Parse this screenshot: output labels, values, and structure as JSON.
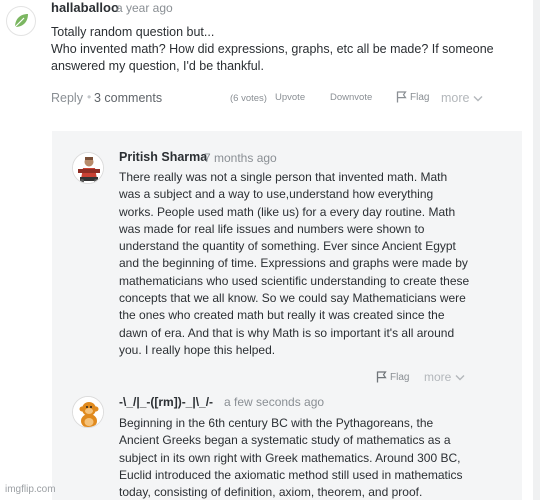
{
  "top_comment": {
    "username": "hallaballoo",
    "time": "a year ago",
    "line1": "Totally random question but...",
    "line2": "Who invented math? How did expressions, graphs, etc all be made? If someone",
    "line3": "answered my question, I'd be thankful.",
    "reply_label": "Reply",
    "separator": "•",
    "comments_count": "3 comments",
    "votes": "(6 votes)",
    "upvote_label": "Upvote",
    "downvote_label": "Downvote",
    "flag_label": "Flag",
    "more_label": "more"
  },
  "reply1": {
    "username": "Pritish Sharma",
    "time": "7 months ago",
    "body": "There really was not a single person that invented math. Math was a subject and a way to use,understand how everything works. People used math (like us) for a every day routine. Math was made for real life issues and numbers were shown to understand the quantity of something. Ever since Ancient Egypt and the beginning of time. Expressions and graphs were made by mathematicians who used scientific understanding to create these concepts that we all know. So we could say Mathematicians were the ones who created math but really it was created since the dawn of era. And that is why Math is so important it's all around you. I really hope this helped.",
    "flag_label": "Flag",
    "more_label": "more"
  },
  "reply2": {
    "username": "-\\_/|_-([rm])-_|\\_/-",
    "time": "a few seconds ago",
    "body": "Beginning in the 6th century BC with the Pythagoreans, the Ancient Greeks began a systematic study of mathematics as a subject in its own right with Greek mathematics. Around 300 BC, Euclid introduced the axiomatic method still used in mathematics today, consisting of definition, axiom, theorem, and proof."
  },
  "watermark": "imgflip.com",
  "colors": {
    "leaf_green": "#7bb661",
    "reply_panel_bg": "#f4f5f6",
    "muted_text": "#8a8f94"
  }
}
